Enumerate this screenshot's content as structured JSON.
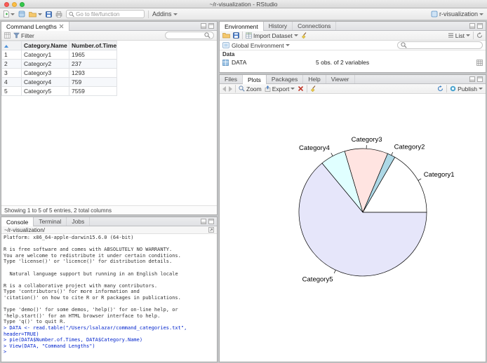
{
  "window": {
    "title": "~/r-visualization - RStudio",
    "project_label": "r-visualization"
  },
  "toolbar": {
    "goto_placeholder": "Go to file/function",
    "addins_label": "Addins"
  },
  "data_viewer": {
    "tab_title": "Command Lengths",
    "filter_label": "Filter",
    "columns": [
      "",
      "Category.Name",
      "Number.of.Times"
    ],
    "rows": [
      {
        "num": "1",
        "name": "Category1",
        "times": "1965"
      },
      {
        "num": "2",
        "name": "Category2",
        "times": "237"
      },
      {
        "num": "3",
        "name": "Category3",
        "times": "1293"
      },
      {
        "num": "4",
        "name": "Category4",
        "times": "759"
      },
      {
        "num": "5",
        "name": "Category5",
        "times": "7559"
      }
    ],
    "footer": "Showing 1 to 5 of 5 entries, 2 total columns"
  },
  "console": {
    "tabs": [
      "Console",
      "Terminal",
      "Jobs"
    ],
    "path": "~/r-visualization/",
    "output": "Platform: x86_64-apple-darwin15.6.0 (64-bit)\n\nR is free software and comes with ABSOLUTELY NO WARRANTY.\nYou are welcome to redistribute it under certain conditions.\nType 'license()' or 'licence()' for distribution details.\n\n  Natural language support but running in an English locale\n\nR is a collaborative project with many contributors.\nType 'contributors()' for more information and\n'citation()' on how to cite R or R packages in publications.\n\nType 'demo()' for some demos, 'help()' for on-line help, or\n'help.start()' for an HTML browser interface to help.\nType 'q()' to quit R.\n",
    "input": "> DATA <- read.table(\"/Users/lsalazar/command_categories.txt\", header=TRUE)\n> pie(DATA$Number.of.Times, DATA$Category.Name)\n> View(DATA, \"Command Lengths\")\n> "
  },
  "environment": {
    "tabs": [
      "Environment",
      "History",
      "Connections"
    ],
    "import_label": "Import Dataset",
    "list_label": "List",
    "scope_label": "Global Environment",
    "section_label": "Data",
    "object": {
      "name": "DATA",
      "summary": "5 obs. of 2 variables"
    }
  },
  "plots": {
    "tabs": [
      "Files",
      "Plots",
      "Packages",
      "Help",
      "Viewer"
    ],
    "zoom_label": "Zoom",
    "export_label": "Export",
    "publish_label": "Publish"
  },
  "chart_data": {
    "type": "pie",
    "title": "",
    "categories": [
      "Category1",
      "Category2",
      "Category3",
      "Category4",
      "Category5"
    ],
    "values": [
      1965,
      237,
      1293,
      759,
      7559
    ],
    "colors": [
      "#FFFFFF",
      "#ADD8E6",
      "#FFE4E1",
      "#E0FFFF",
      "#E6E6FA"
    ],
    "start_angle_deg": 0,
    "direction": "counterclockwise",
    "legend": "none",
    "label_color": "#000000"
  }
}
